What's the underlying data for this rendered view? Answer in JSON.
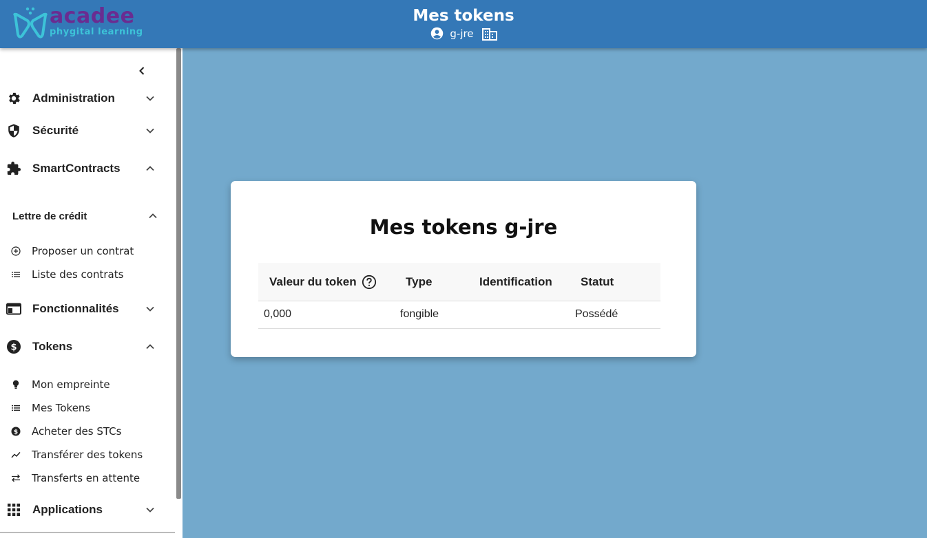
{
  "header": {
    "logo_main": "acadee",
    "logo_tagline": "phygital learning",
    "title": "Mes tokens",
    "username": "g-jre",
    "colors": {
      "header_bg": "#3478b7",
      "page_bg": "#73a9cc",
      "logo_primary": "#6a2c91",
      "logo_accent": "#3dc3d8"
    }
  },
  "sidebar": {
    "collapse_icon": "chevron-left-icon",
    "items": [
      {
        "label": "Administration",
        "icon": "gear-icon",
        "expanded": false
      },
      {
        "label": "Sécurité",
        "icon": "shield-icon",
        "expanded": false
      },
      {
        "label": "SmartContracts",
        "icon": "puzzle-icon",
        "expanded": true
      },
      {
        "label": "Fonctionnalités",
        "icon": "window-icon",
        "expanded": false
      },
      {
        "label": "Tokens",
        "icon": "dollar-circle-icon",
        "expanded": true
      },
      {
        "label": "Applications",
        "icon": "grid-icon",
        "expanded": false
      }
    ],
    "smartcontracts_section": {
      "label": "Lettre de crédit",
      "sub_items": [
        {
          "label": "Proposer un contrat",
          "icon": "add-circle-icon"
        },
        {
          "label": "Liste des contrats",
          "icon": "list-icon"
        }
      ]
    },
    "tokens_sub_items": [
      {
        "label": "Mon empreinte",
        "icon": "lightbulb-icon"
      },
      {
        "label": "Mes Tokens",
        "icon": "list-icon"
      },
      {
        "label": "Acheter des STCs",
        "icon": "dollar-circle-icon"
      },
      {
        "label": "Transférer des tokens",
        "icon": "trend-icon"
      },
      {
        "label": "Transferts en attente",
        "icon": "swap-icon"
      }
    ]
  },
  "card": {
    "title": "Mes tokens g-jre",
    "columns": [
      "Valeur du token",
      "Type",
      "Identification",
      "Statut"
    ],
    "rows": [
      {
        "value": "0,000",
        "type": "fongible",
        "identification": "",
        "status": "Possédé"
      }
    ]
  }
}
